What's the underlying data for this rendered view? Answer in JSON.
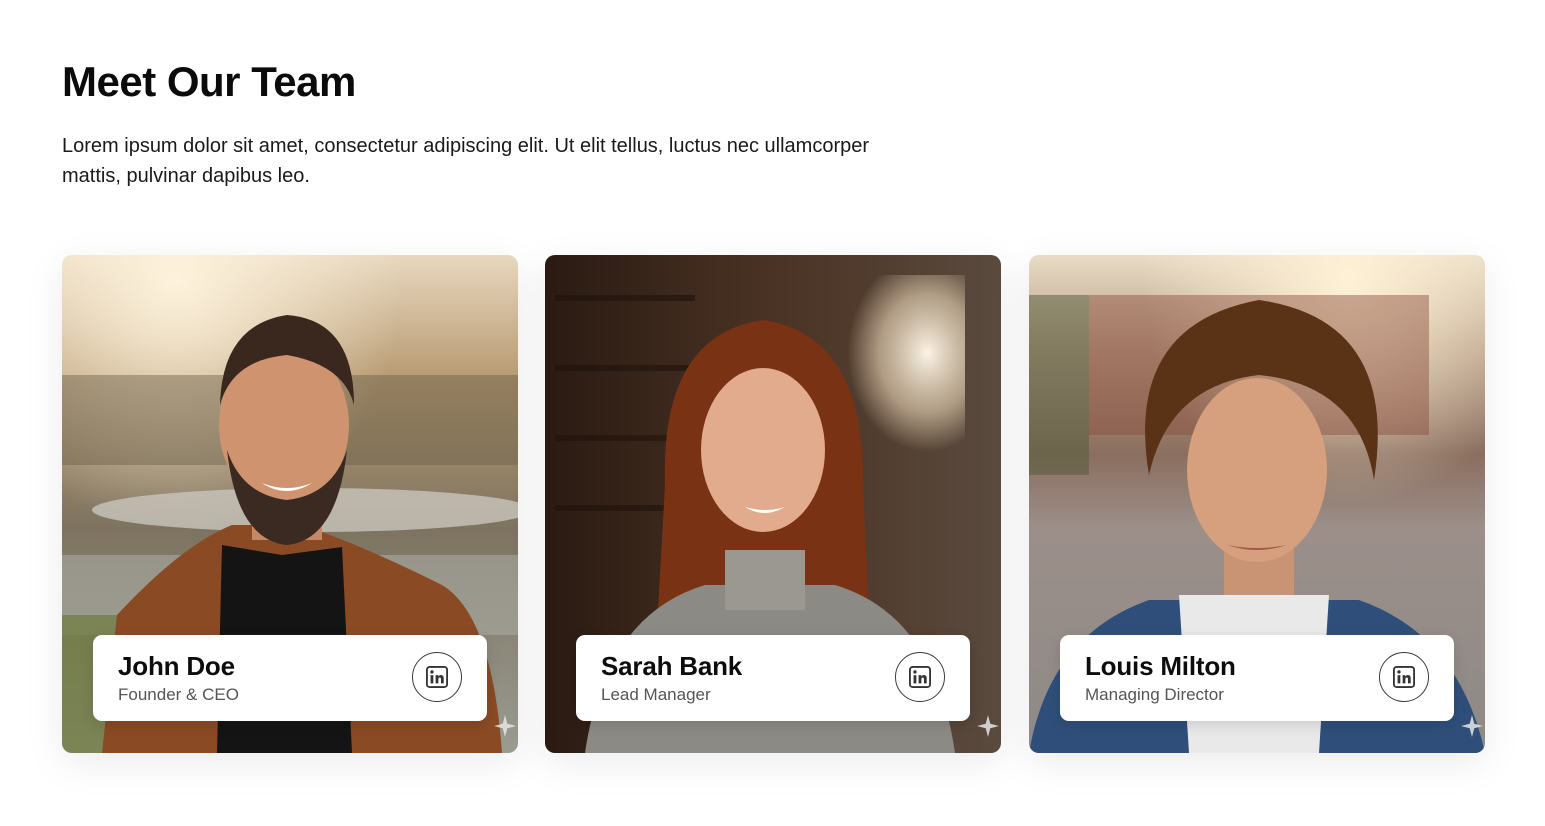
{
  "section": {
    "title": "Meet Our Team",
    "description": "Lorem ipsum dolor sit amet, consectetur adipiscing elit. Ut elit tellus, luctus nec ullamcorper mattis, pulvinar dapibus leo."
  },
  "team": [
    {
      "name": "John Doe",
      "role": "Founder & CEO",
      "icon": "linkedin-icon"
    },
    {
      "name": "Sarah Bank",
      "role": "Lead Manager",
      "icon": "linkedin-icon"
    },
    {
      "name": "Louis Milton",
      "role": "Managing Director",
      "icon": "linkedin-icon"
    }
  ],
  "colors": {
    "text": "#0b0b0b",
    "muted": "#555555",
    "card_bg": "#ffffff"
  }
}
